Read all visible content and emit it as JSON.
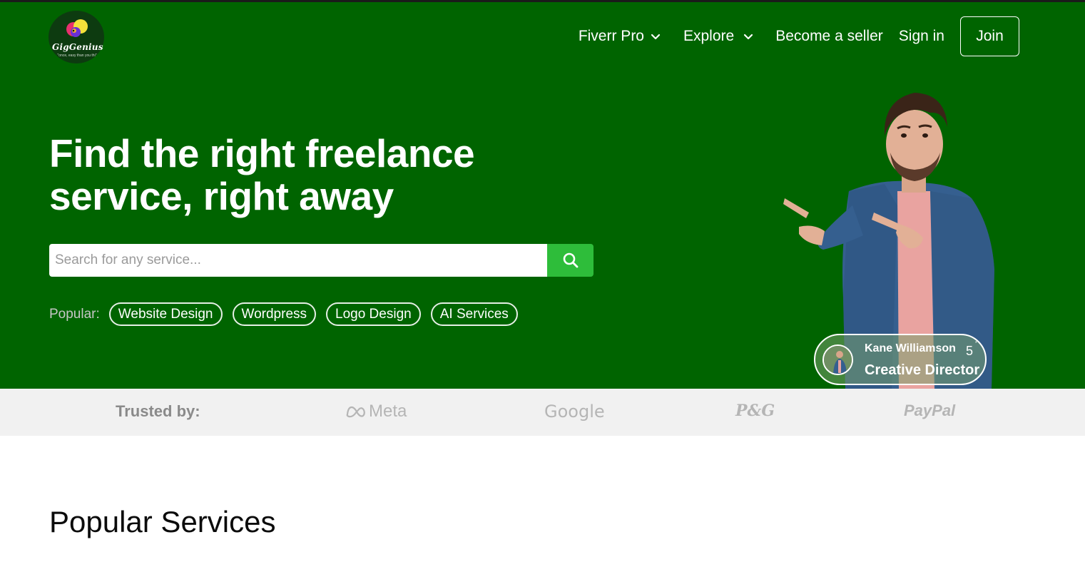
{
  "brand": {
    "name": "GigGenius",
    "tagline": "\"once, easy than you thi\""
  },
  "nav": {
    "items": [
      {
        "label": "Fiverr Pro",
        "has_dropdown": true
      },
      {
        "label": "Explore",
        "has_dropdown": true
      },
      {
        "label": "Become a seller",
        "has_dropdown": false
      },
      {
        "label": "Sign in",
        "has_dropdown": false
      }
    ],
    "join_label": "Join"
  },
  "hero": {
    "headline_line1": "Find the right freelance",
    "headline_line2": "service, right away",
    "search": {
      "placeholder": "Search for any service...",
      "value": "",
      "button_icon": "search-icon"
    },
    "popular": {
      "label": "Popular:",
      "tags": [
        "Website Design",
        "Wordpress",
        "Logo Design",
        "AI Services"
      ]
    },
    "profile": {
      "name": "Kane Williamson",
      "rating": "5",
      "star": "*",
      "role": "Creative Director"
    }
  },
  "trusted": {
    "label": "Trusted by:",
    "brands": [
      "Meta",
      "Google",
      "P&G",
      "PayPal"
    ]
  },
  "sections": {
    "popular_services_title": "Popular Services"
  },
  "colors": {
    "hero_bg": "#006400",
    "search_button": "#2ebd3a",
    "trusted_bg": "#f1f1f1"
  }
}
